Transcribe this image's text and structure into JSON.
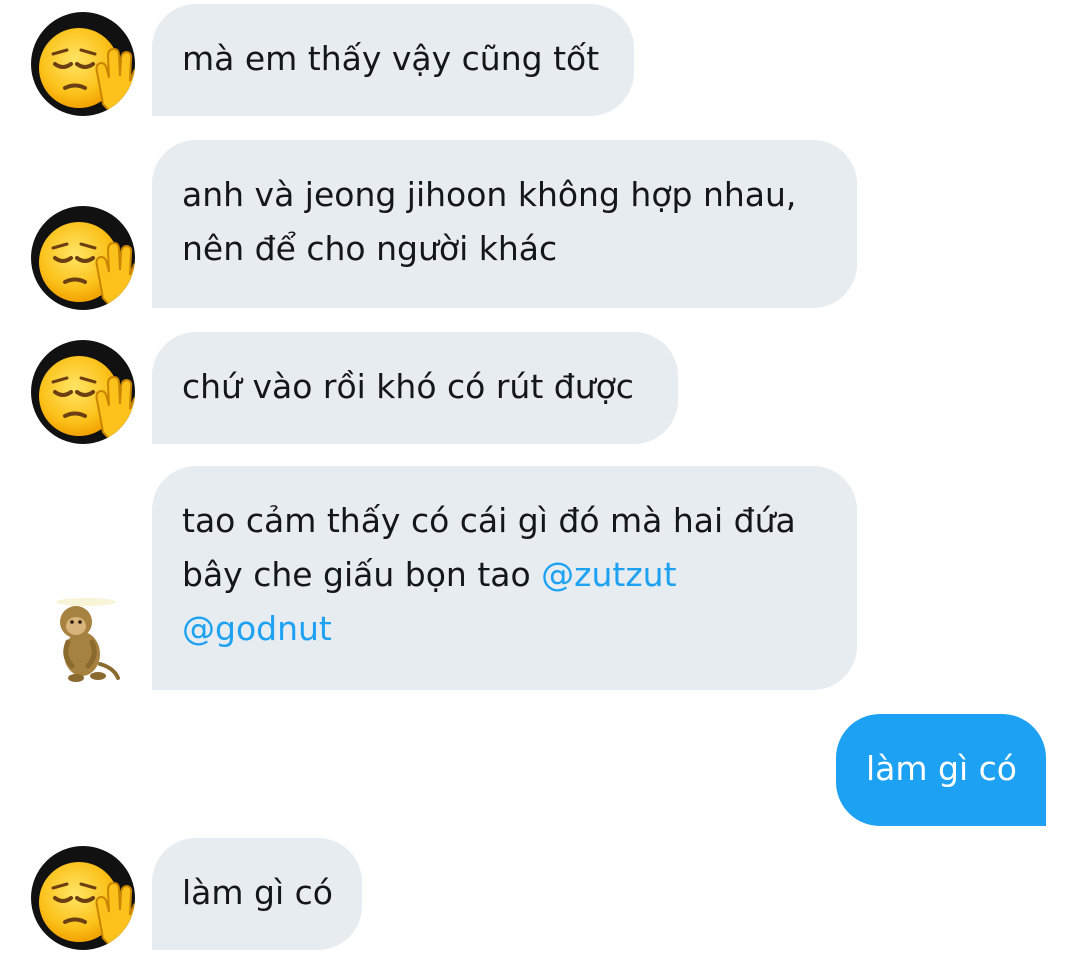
{
  "conversation": {
    "messages": [
      {
        "direction": "incoming",
        "avatar": "pensive-wave-emoji",
        "lines": [
          "mà em thấy vậy cũng tốt"
        ]
      },
      {
        "direction": "incoming",
        "avatar": "pensive-wave-emoji",
        "lines": [
          "anh và jeong jihoon không hợp nhau,",
          "nên để cho người khác"
        ]
      },
      {
        "direction": "incoming",
        "avatar": "pensive-wave-emoji",
        "lines": [
          "chứ vào rồi khó có rút được"
        ]
      },
      {
        "direction": "incoming",
        "avatar": "monkey-sticker",
        "text_before": "tao cảm thấy có cái gì đó mà hai đứa",
        "line2_text": "bây che giấu bọn tao ",
        "mention_1": "@zutzut",
        "mention_2": "@godnut"
      },
      {
        "direction": "outgoing",
        "lines": [
          "làm gì có"
        ]
      },
      {
        "direction": "incoming",
        "avatar": "pensive-wave-emoji",
        "lines": [
          "làm gì có"
        ]
      }
    ]
  },
  "colors": {
    "incoming_bubble": "#e6ecf0",
    "outgoing_bubble": "#1da1f2",
    "mention": "#1da1f2",
    "text": "#14171a"
  }
}
